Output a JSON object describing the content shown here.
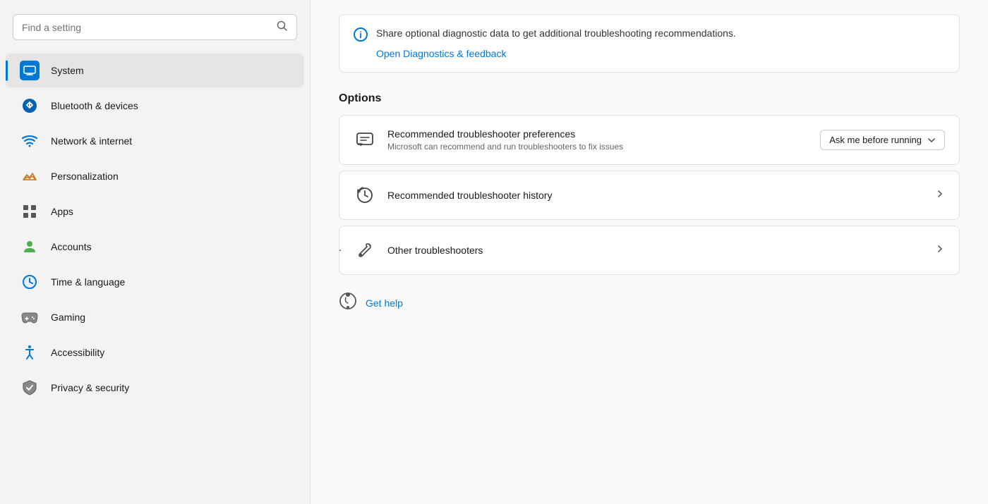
{
  "sidebar": {
    "search_placeholder": "Find a setting",
    "items": [
      {
        "id": "system",
        "label": "System",
        "icon": "system",
        "active": true
      },
      {
        "id": "bluetooth",
        "label": "Bluetooth & devices",
        "icon": "bluetooth",
        "active": false
      },
      {
        "id": "network",
        "label": "Network & internet",
        "icon": "network",
        "active": false
      },
      {
        "id": "personalization",
        "label": "Personalization",
        "icon": "personalization",
        "active": false
      },
      {
        "id": "apps",
        "label": "Apps",
        "icon": "apps",
        "active": false
      },
      {
        "id": "accounts",
        "label": "Accounts",
        "icon": "accounts",
        "active": false
      },
      {
        "id": "time",
        "label": "Time & language",
        "icon": "time",
        "active": false
      },
      {
        "id": "gaming",
        "label": "Gaming",
        "icon": "gaming",
        "active": false
      },
      {
        "id": "accessibility",
        "label": "Accessibility",
        "icon": "accessibility",
        "active": false
      },
      {
        "id": "privacy",
        "label": "Privacy & security",
        "icon": "privacy",
        "active": false
      }
    ]
  },
  "main": {
    "diagnostic_info": "Share optional diagnostic data to get additional troubleshooting recommendations.",
    "diagnostic_link": "Open Diagnostics & feedback",
    "options_title": "Options",
    "options": [
      {
        "id": "recommended-prefs",
        "icon": "chat-icon",
        "title": "Recommended troubleshooter preferences",
        "desc": "Microsoft can recommend and run troubleshooters to fix issues",
        "control_type": "dropdown",
        "dropdown_label": "Ask me before running"
      },
      {
        "id": "recommended-history",
        "icon": "history-icon",
        "title": "Recommended troubleshooter history",
        "desc": "",
        "control_type": "chevron"
      },
      {
        "id": "other-troubleshooters",
        "icon": "wrench-icon",
        "title": "Other troubleshooters",
        "desc": "",
        "control_type": "chevron"
      }
    ],
    "get_help_label": "Get help"
  }
}
